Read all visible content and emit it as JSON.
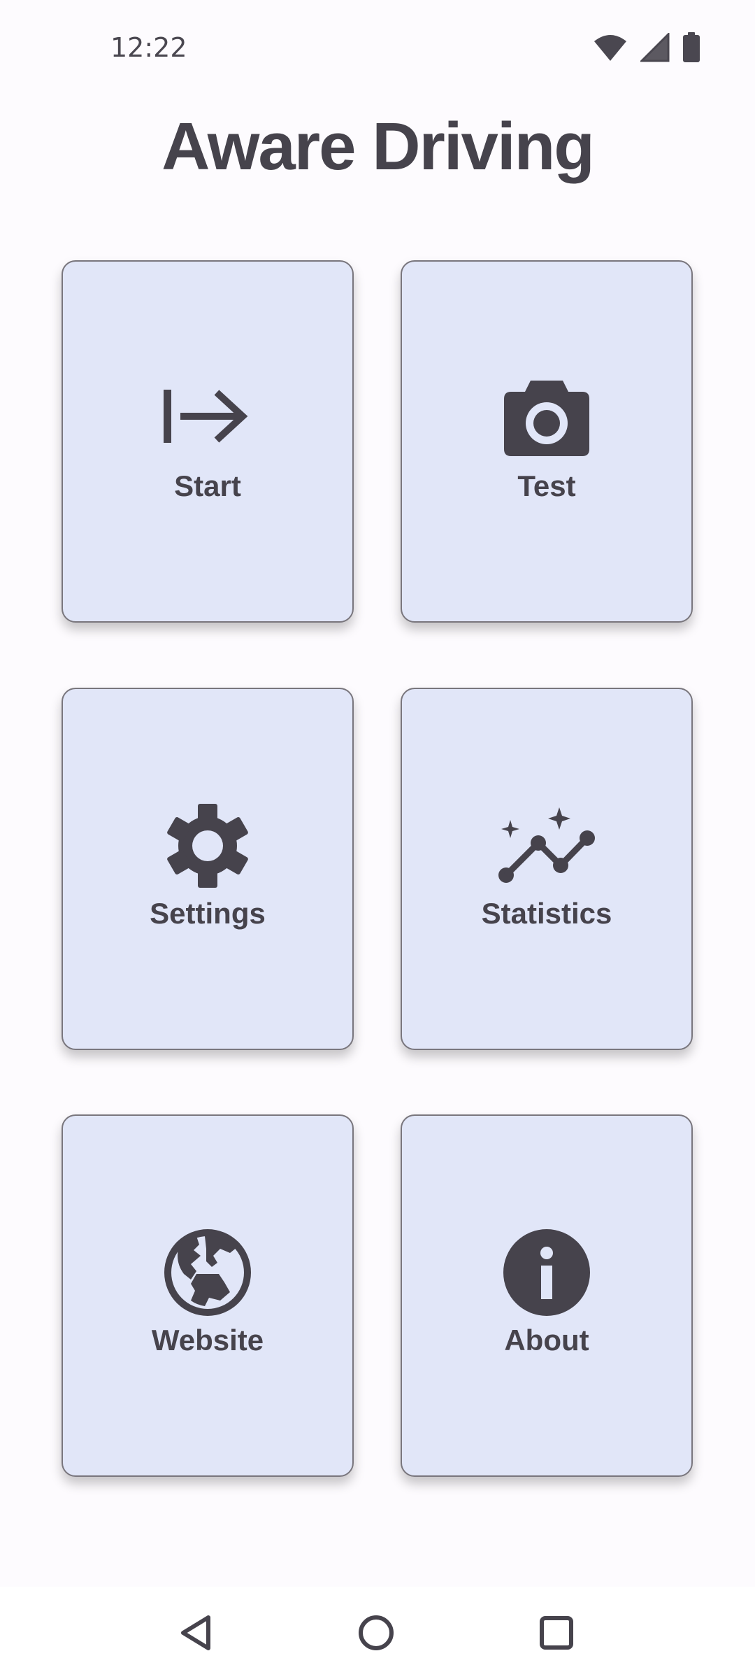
{
  "status_bar": {
    "time": "12:22",
    "icons": [
      "wifi-icon",
      "cell-signal-icon",
      "battery-icon"
    ]
  },
  "app": {
    "title": "Aware Driving"
  },
  "tiles": [
    {
      "label": "Start",
      "icon": "arrow-right-to-line-icon"
    },
    {
      "label": "Test",
      "icon": "camera-icon"
    },
    {
      "label": "Settings",
      "icon": "gear-icon"
    },
    {
      "label": "Statistics",
      "icon": "auto-graph-icon"
    },
    {
      "label": "Website",
      "icon": "globe-icon"
    },
    {
      "label": "About",
      "icon": "info-icon"
    }
  ],
  "nav_bar": {
    "buttons": [
      "back-icon",
      "home-icon",
      "recents-icon"
    ]
  },
  "colors": {
    "background": "#fdfbfe",
    "tile_fill": "#e1e6f8",
    "tile_border": "#79767d",
    "text": "#46434c"
  }
}
